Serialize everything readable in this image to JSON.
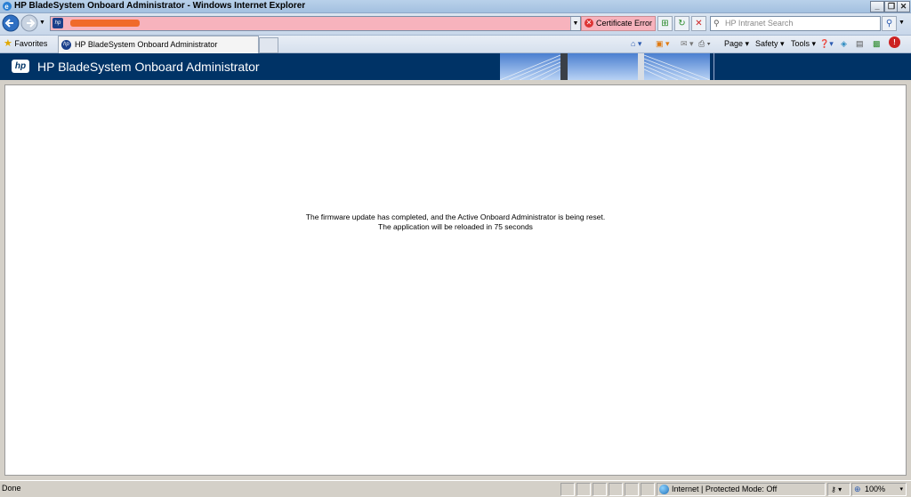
{
  "window": {
    "title": "HP BladeSystem Onboard Administrator - Windows Internet Explorer",
    "controls": [
      "minimize",
      "restore",
      "close"
    ]
  },
  "navbar": {
    "back_icon": "back-arrow-icon",
    "forward_icon": "forward-arrow-icon",
    "certificate_error": "Certificate Error",
    "search_placeholder": "HP Intranet Search"
  },
  "favbar": {
    "favorites_label": "Favorites",
    "tab_title": "HP BladeSystem Onboard Administrator",
    "commands": {
      "page": "Page",
      "safety": "Safety",
      "tools": "Tools"
    }
  },
  "header": {
    "logo": "hp",
    "title": "HP BladeSystem Onboard Administrator"
  },
  "content": {
    "message_line1": "The firmware update has completed, and the Active Onboard Administrator is being reset.",
    "message_line2": "The application will be reloaded in 75 seconds"
  },
  "statusbar": {
    "status_text": "Done",
    "zone_text": "Internet | Protected Mode: Off",
    "zoom": "100%"
  }
}
